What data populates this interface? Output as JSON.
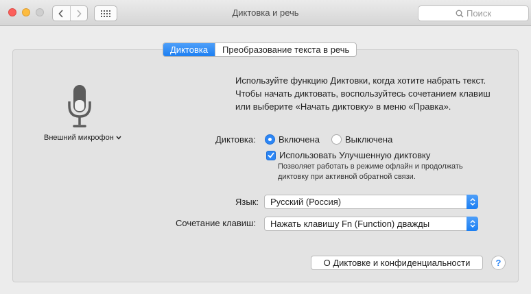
{
  "window": {
    "title": "Диктовка и речь"
  },
  "search": {
    "placeholder": "Поиск"
  },
  "tabs": [
    {
      "label": "Диктовка",
      "active": true
    },
    {
      "label": "Преобразование текста в речь",
      "active": false
    }
  ],
  "microphone": {
    "name": "Внешний микрофон"
  },
  "description": "Используйте функцию Диктовки, когда хотите набрать текст. Чтобы начать диктовать, воспользуйтесь сочетанием клавиш или выберите «Начать диктовку» в меню «Правка».",
  "dictation": {
    "label": "Диктовка:",
    "on_label": "Включена",
    "off_label": "Выключена",
    "selected": "on",
    "enhanced_label": "Использовать Улучшенную диктовку",
    "enhanced_checked": true,
    "enhanced_note": "Позволяет работать в режиме офлайн и продолжать диктовку при активной обратной связи."
  },
  "language": {
    "label": "Язык:",
    "value": "Русский (Россия)"
  },
  "shortcut": {
    "label": "Сочетание клавиш:",
    "value": "Нажать клавишу Fn (Function) дважды"
  },
  "privacy_button": "О Диктовке и конфиденциальности",
  "help_button": "?",
  "colors": {
    "accent": "#2c86f5",
    "close": "#fc605c",
    "minimize": "#fdbc40"
  }
}
